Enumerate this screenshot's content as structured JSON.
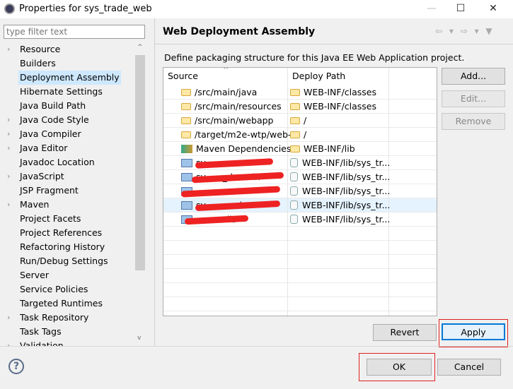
{
  "window": {
    "title": "Properties for sys_trade_web",
    "minimize": "—",
    "maximize": "☐",
    "close": "✕"
  },
  "filter": {
    "placeholder": "type filter text"
  },
  "tree": [
    {
      "label": "Resource",
      "expandable": true
    },
    {
      "label": "Builders",
      "expandable": false
    },
    {
      "label": "Deployment Assembly",
      "expandable": false,
      "selected": true
    },
    {
      "label": "Hibernate Settings",
      "expandable": false
    },
    {
      "label": "Java Build Path",
      "expandable": false
    },
    {
      "label": "Java Code Style",
      "expandable": true
    },
    {
      "label": "Java Compiler",
      "expandable": true
    },
    {
      "label": "Java Editor",
      "expandable": true
    },
    {
      "label": "Javadoc Location",
      "expandable": false
    },
    {
      "label": "JavaScript",
      "expandable": true
    },
    {
      "label": "JSP Fragment",
      "expandable": false
    },
    {
      "label": "Maven",
      "expandable": true
    },
    {
      "label": "Project Facets",
      "expandable": false
    },
    {
      "label": "Project References",
      "expandable": false
    },
    {
      "label": "Refactoring History",
      "expandable": false
    },
    {
      "label": "Run/Debug Settings",
      "expandable": false
    },
    {
      "label": "Server",
      "expandable": false
    },
    {
      "label": "Service Policies",
      "expandable": false
    },
    {
      "label": "Targeted Runtimes",
      "expandable": false
    },
    {
      "label": "Task Repository",
      "expandable": true
    },
    {
      "label": "Task Tags",
      "expandable": false
    },
    {
      "label": "Validation",
      "expandable": true
    }
  ],
  "page": {
    "title": "Web Deployment Assembly",
    "description": "Define packaging structure for this Java EE Web Application project.",
    "nav_icons": "⇦ ▾ ⇨ ▾ ▼"
  },
  "table": {
    "columns": [
      "Source",
      "Deploy Path"
    ],
    "sort_indicator": "^",
    "rows": [
      {
        "source": "/src/main/java",
        "path": "WEB-INF/classes",
        "icon": "folder"
      },
      {
        "source": "/src/main/resources",
        "path": "WEB-INF/classes",
        "icon": "folder"
      },
      {
        "source": "/src/main/webapp",
        "path": "/",
        "icon": "folder"
      },
      {
        "source": "/target/m2e-wtp/web-",
        "path": "/",
        "icon": "folder"
      },
      {
        "source": "Maven Dependencies",
        "path": "WEB-INF/lib",
        "icon": "maven"
      },
      {
        "source": "sy          o",
        "path": "WEB-INF/lib/sys_tr...",
        "icon": "project",
        "redacted": true
      },
      {
        "source": "sy      _domain",
        "path": "WEB-INF/lib/sys_tr...",
        "icon": "project",
        "redacted": true
      },
      {
        "source": "             on",
        "path": "WEB-INF/lib/sys_tr...",
        "icon": "project",
        "redacted": true
      },
      {
        "source": "sy            ice",
        "path": "WEB-INF/lib/sys_tr...",
        "icon": "project",
        "redacted": true,
        "highlighted": true
      },
      {
        "source": "           ils",
        "path": "WEB-INF/lib/sys_tr...",
        "icon": "project",
        "redacted": true
      }
    ]
  },
  "buttons": {
    "add": "Add...",
    "edit": "Edit...",
    "remove": "Remove",
    "revert": "Revert",
    "apply": "Apply",
    "ok": "OK",
    "cancel": "Cancel",
    "help": "?"
  }
}
